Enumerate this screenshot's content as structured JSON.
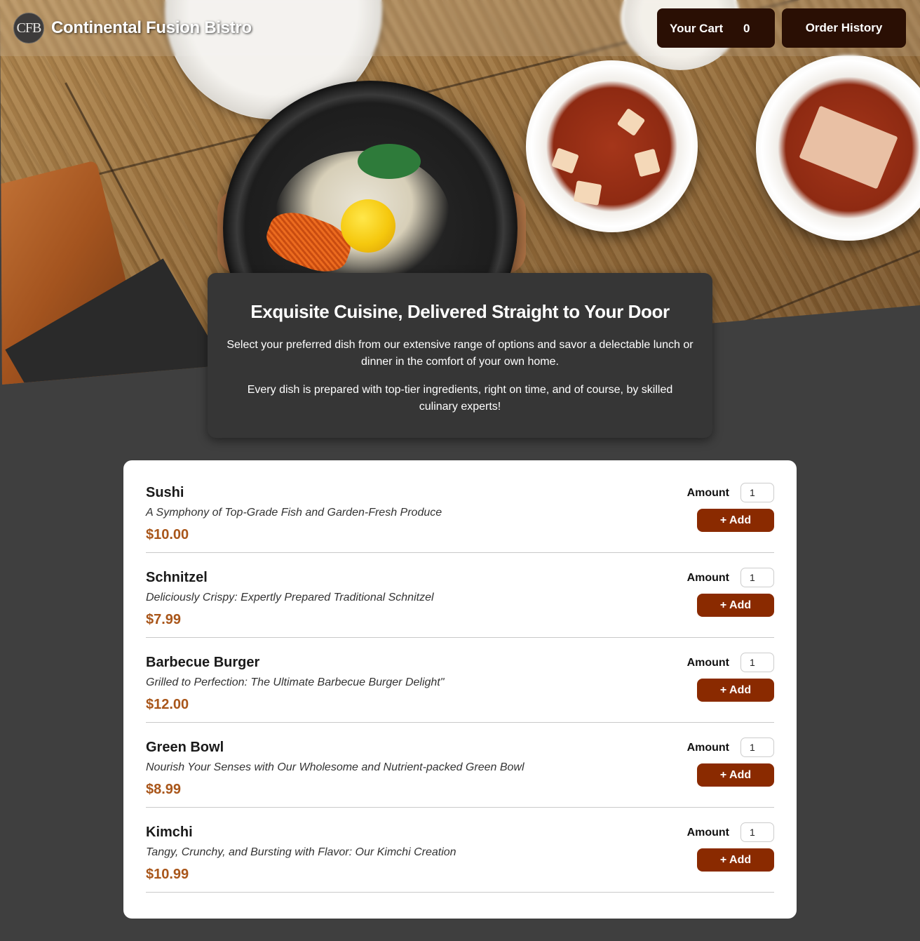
{
  "header": {
    "logo_text": "CFB",
    "brand": "Continental Fusion Bistro",
    "cart_label": "Your Cart",
    "cart_count": "0",
    "history_label": "Order History"
  },
  "intro": {
    "title": "Exquisite Cuisine, Delivered Straight to Your Door",
    "paragraph_1": "Select your preferred dish from our extensive range of options and savor a delectable lunch or dinner in the comfort of your own home.",
    "paragraph_2": "Every dish is prepared with top-tier ingredients, right on time, and of course, by skilled culinary experts!"
  },
  "menu": {
    "amount_label": "Amount",
    "add_label": "+ Add",
    "items": [
      {
        "name": "Sushi",
        "description": "A Symphony of Top-Grade Fish and Garden-Fresh Produce",
        "price": "$10.00",
        "amount": "1"
      },
      {
        "name": "Schnitzel",
        "description": "Deliciously Crispy: Expertly Prepared Traditional Schnitzel",
        "price": "$7.99",
        "amount": "1"
      },
      {
        "name": "Barbecue Burger",
        "description": "Grilled to Perfection: The Ultimate Barbecue Burger Delight\"",
        "price": "$12.00",
        "amount": "1"
      },
      {
        "name": "Green Bowl",
        "description": "Nourish Your Senses with Our Wholesome and Nutrient-packed Green Bowl",
        "price": "$8.99",
        "amount": "1"
      },
      {
        "name": "Kimchi",
        "description": "Tangy, Crunchy, and Bursting with Flavor: Our Kimchi Creation",
        "price": "$10.99",
        "amount": "1"
      }
    ]
  },
  "colors": {
    "page_background": "#3f3f3f",
    "header_button": "#2a0f04",
    "add_button": "#8a2a00",
    "price": "#a9561a",
    "intro_panel": "#363636"
  }
}
